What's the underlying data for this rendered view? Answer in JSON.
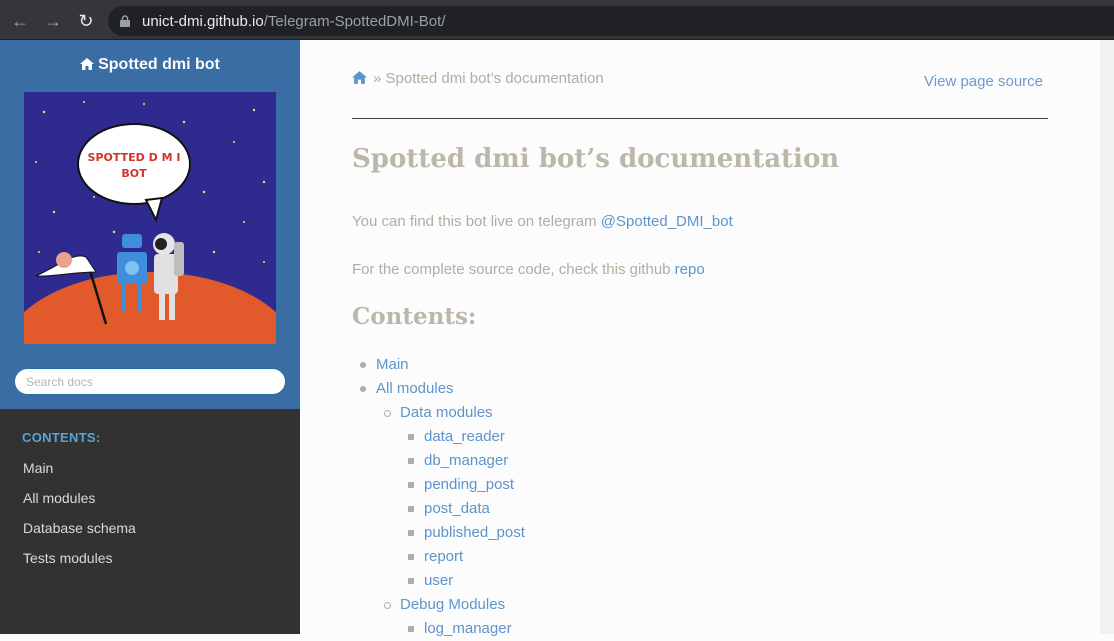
{
  "browser": {
    "url_host": "unict-dmi.github.io",
    "url_path": "/Telegram-SpottedDMI-Bot/"
  },
  "sidebar": {
    "project_title": "Spotted dmi bot",
    "logo_text_line1": "SPOTTED D M I",
    "logo_text_line2": "BOT",
    "search_placeholder": "Search docs",
    "contents_caption": "CONTENTS:",
    "nav": [
      "Main",
      "All modules",
      "Database schema",
      "Tests modules"
    ]
  },
  "main": {
    "breadcrumb_sep": "»",
    "breadcrumb_current": "Spotted dmi bot’s documentation",
    "view_source": "View page source",
    "title": "Spotted dmi bot’s documentation",
    "p1_text": "You can find this bot live on telegram ",
    "p1_link": "@Spotted_DMI_bot",
    "p2_text": "For the complete source code, check this github ",
    "p2_link": "repo",
    "contents_heading": "Contents:",
    "toc": [
      {
        "level": 1,
        "label": "Main"
      },
      {
        "level": 1,
        "label": "All modules"
      },
      {
        "level": 2,
        "label": "Data modules"
      },
      {
        "level": 3,
        "label": "data_reader"
      },
      {
        "level": 3,
        "label": "db_manager"
      },
      {
        "level": 3,
        "label": "pending_post"
      },
      {
        "level": 3,
        "label": "post_data"
      },
      {
        "level": 3,
        "label": "published_post"
      },
      {
        "level": 3,
        "label": "report"
      },
      {
        "level": 3,
        "label": "user"
      },
      {
        "level": 2,
        "label": "Debug Modules"
      },
      {
        "level": 3,
        "label": "log_manager"
      }
    ]
  },
  "colors": {
    "sidebar_top": "#3a6da3",
    "sidebar_bottom": "#343131",
    "link": "#5e94cc",
    "muted_text": "#b3aca0"
  }
}
